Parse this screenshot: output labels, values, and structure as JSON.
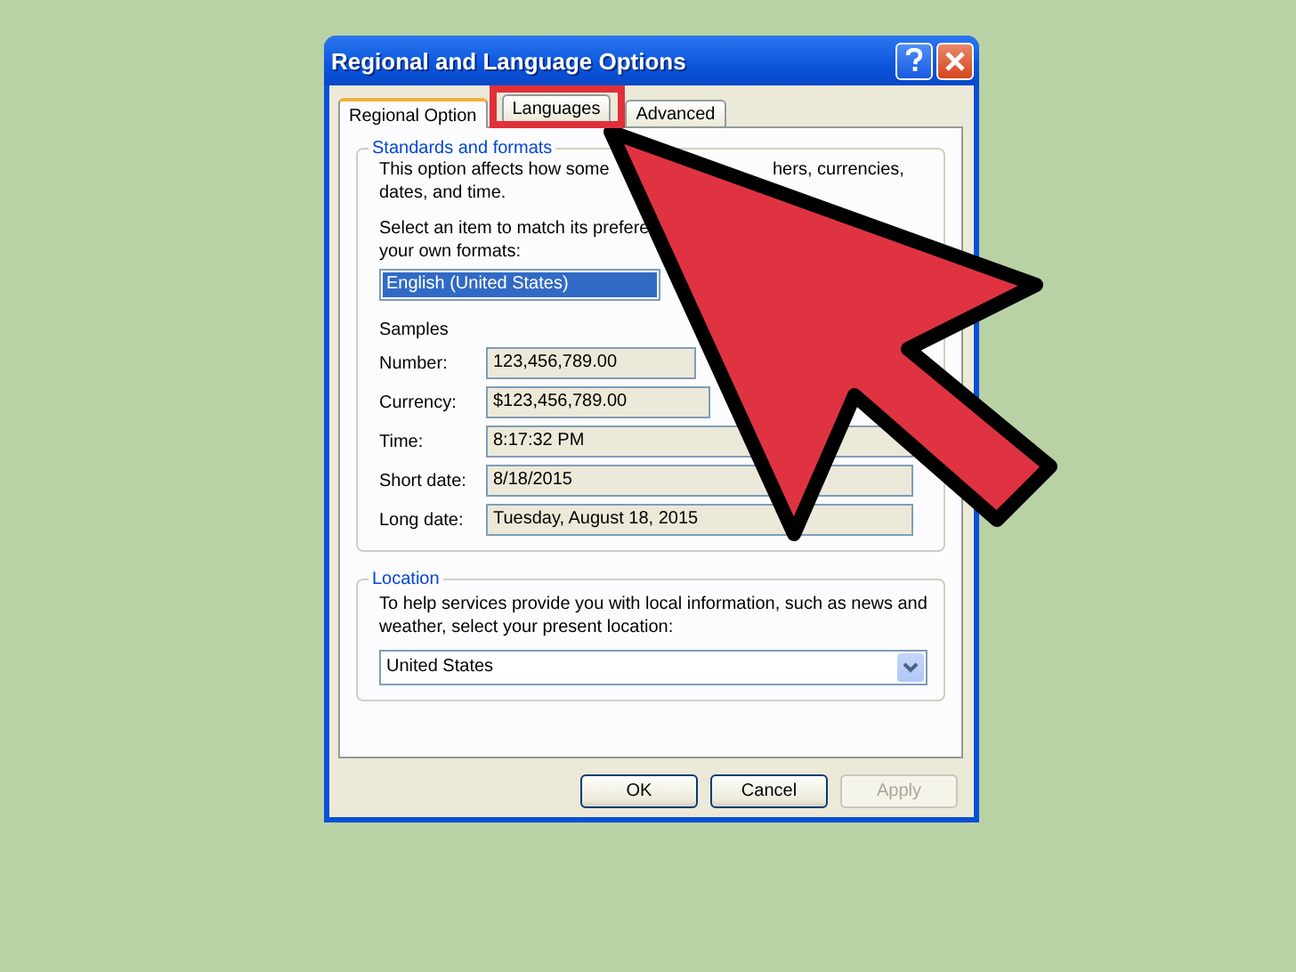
{
  "window": {
    "title": "Regional and Language Options"
  },
  "tabs": [
    {
      "label": "Regional Option",
      "selected": true,
      "highlighted": false
    },
    {
      "label": "Languages",
      "selected": false,
      "highlighted": true
    },
    {
      "label": "Advanced",
      "selected": false,
      "highlighted": false
    }
  ],
  "standards": {
    "legend": "Standards and formats",
    "description_lines": [
      [
        "This option affects how some",
        "hers, currencies,"
      ],
      [
        "dates, and time."
      ]
    ],
    "prompt_lines": [
      [
        "Select an item to match its prefere"
      ],
      [
        "your own formats:"
      ]
    ],
    "format_field": {
      "value": "English (United States)"
    },
    "samples_heading": "Samples",
    "samples": [
      {
        "label": "Number:",
        "value": "123,456,789.00"
      },
      {
        "label": "Currency:",
        "value": "$123,456,789.00"
      },
      {
        "label": "Time:",
        "value": "8:17:32 PM"
      },
      {
        "label": "Short date:",
        "value": "8/18/2015"
      },
      {
        "label": "Long date:",
        "value": "Tuesday, August 18, 2015"
      }
    ]
  },
  "location": {
    "legend": "Location",
    "description": "To help services provide you with local information, such as news and weather, select your present location:",
    "value": "United States"
  },
  "buttons": [
    {
      "label": "OK",
      "disabled": false
    },
    {
      "label": "Cancel",
      "disabled": false
    },
    {
      "label": "Apply",
      "disabled": true
    }
  ]
}
